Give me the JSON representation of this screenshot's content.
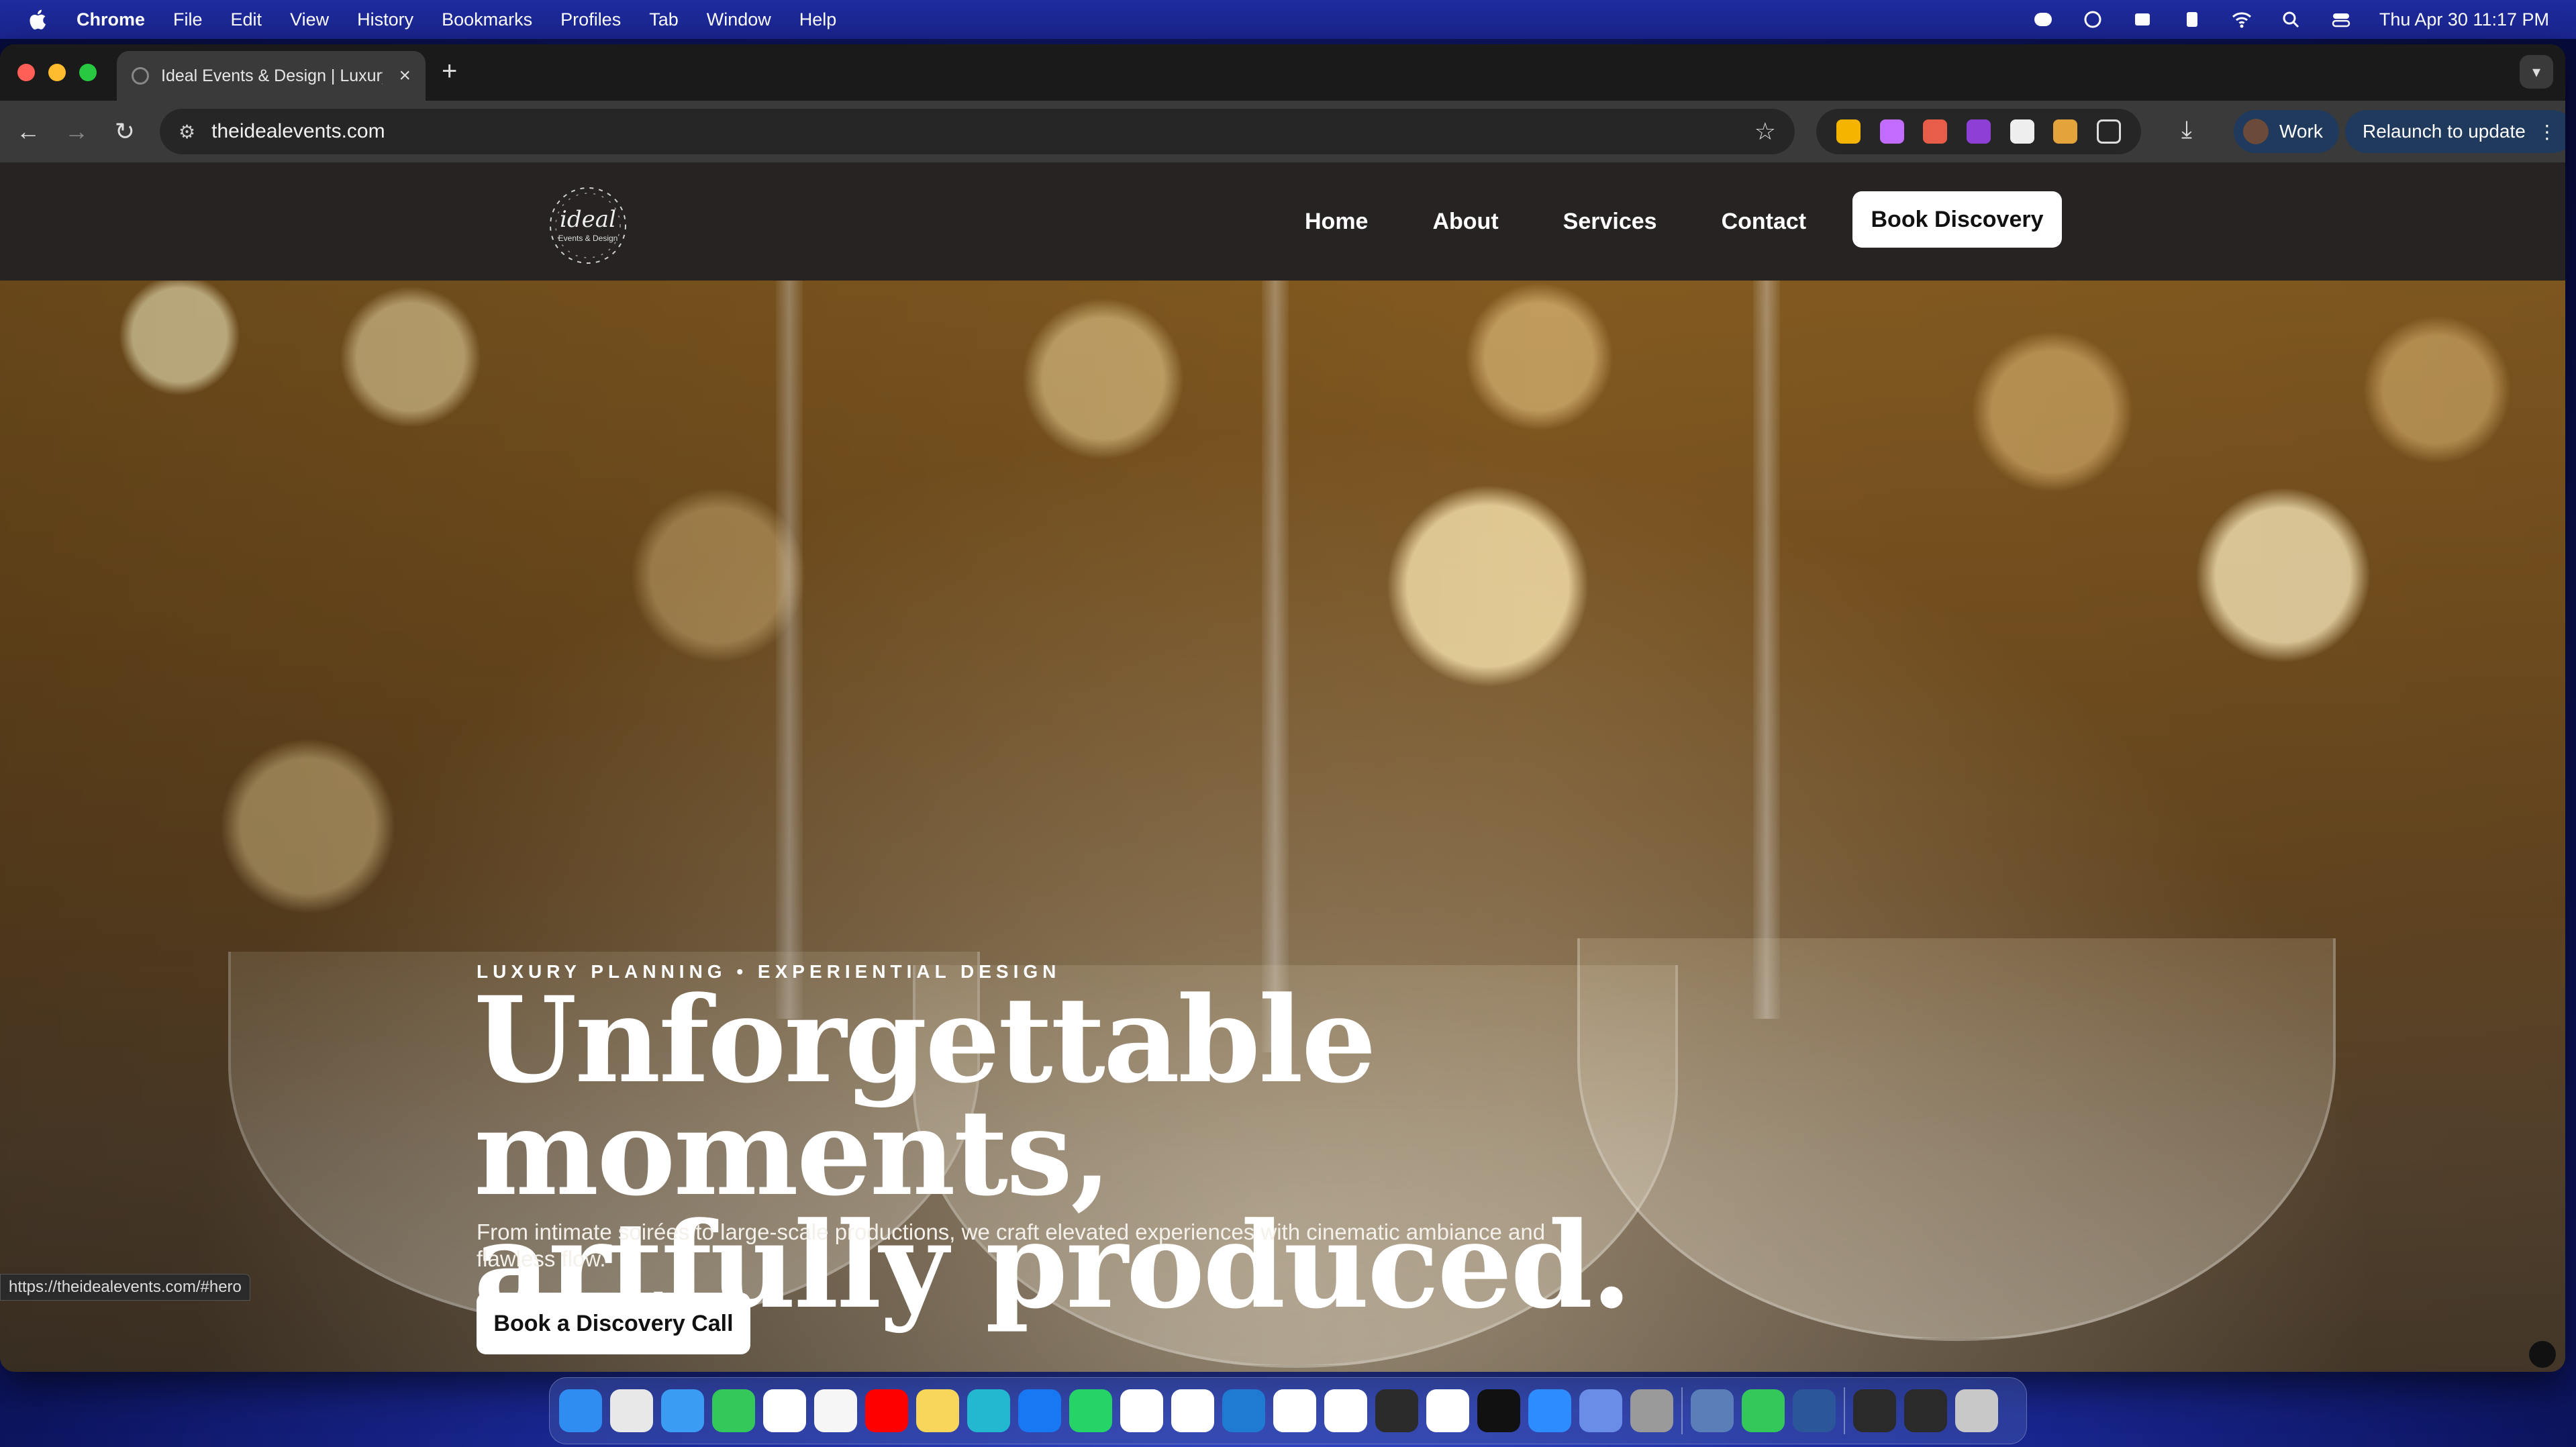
{
  "menubar": {
    "app_name": "Chrome",
    "menus": [
      "File",
      "Edit",
      "View",
      "History",
      "Bookmarks",
      "Profiles",
      "Tab",
      "Window",
      "Help"
    ],
    "clock": "Thu Apr 30  11:17 PM"
  },
  "browser": {
    "tab_title": "Ideal Events & Design | Luxury",
    "tab_close": "×",
    "new_tab": "+",
    "url": "theidealevents.com",
    "profile_label": "Work",
    "relaunch_label": "Relaunch to update",
    "status_url": "https://theidealevents.com/#hero"
  },
  "site": {
    "logo_word": "ideal",
    "logo_sub": "Events & Design",
    "nav": [
      "Home",
      "About",
      "Services",
      "Contact"
    ],
    "nav_cta": "Book Discovery",
    "hero": {
      "eyebrow": "LUXURY PLANNING • EXPERIENTIAL DESIGN",
      "headline_line1": "Unforgettable moments,",
      "headline_line2": "artfully produced.",
      "subtext": "From intimate soirées to large-scale productions, we craft elevated experiences with cinematic ambiance and flawless flow.",
      "cta": "Book a Discovery Call"
    }
  },
  "colors": {
    "menubar_bg": "#1e2b9c",
    "site_nav_bg": "#262322",
    "hero_gold": "#8a5f22",
    "button_bg": "#ffffff"
  },
  "dock": {
    "apps": [
      {
        "name": "finder-icon",
        "color": "#2f8cf0"
      },
      {
        "name": "launchpad-icon",
        "color": "#e8e8e8"
      },
      {
        "name": "safari-icon",
        "color": "#3a9cf2"
      },
      {
        "name": "messages-icon",
        "color": "#34c759"
      },
      {
        "name": "slack-icon",
        "color": "#ffffff"
      },
      {
        "name": "photos-icon",
        "color": "#f6f6f6"
      },
      {
        "name": "youtube-icon",
        "color": "#ff0000"
      },
      {
        "name": "notes-icon",
        "color": "#f7d65a"
      },
      {
        "name": "canva-icon",
        "color": "#22b8cf"
      },
      {
        "name": "facebook-icon",
        "color": "#1877f2"
      },
      {
        "name": "whatsapp-icon",
        "color": "#25d366"
      },
      {
        "name": "capcut-icon",
        "color": "#ffffff"
      },
      {
        "name": "gmail-icon",
        "color": "#ffffff"
      },
      {
        "name": "vscode-icon",
        "color": "#1f7ad2"
      },
      {
        "name": "chatgpt-icon",
        "color": "#ffffff"
      },
      {
        "name": "gemini-icon",
        "color": "#ffffff"
      },
      {
        "name": "claude-icon",
        "color": "#2b2b2b"
      },
      {
        "name": "chrome-icon",
        "color": "#ffffff"
      },
      {
        "name": "perplexity-icon",
        "color": "#111111"
      },
      {
        "name": "zoom-icon",
        "color": "#2d8cff"
      },
      {
        "name": "files-icon",
        "color": "#6a8de8"
      },
      {
        "name": "settings-icon",
        "color": "#9a9a9a"
      }
    ],
    "apps_after": [
      {
        "name": "preview-icon",
        "color": "#5a7fb8"
      },
      {
        "name": "phone-icon",
        "color": "#34c759"
      },
      {
        "name": "word-icon",
        "color": "#2b579a"
      }
    ],
    "tray": [
      {
        "name": "recent-window-1-icon",
        "color": "#2a2a2a"
      },
      {
        "name": "recent-window-2-icon",
        "color": "#2a2a2a"
      },
      {
        "name": "trash-icon",
        "color": "#c8c8c8"
      }
    ]
  }
}
